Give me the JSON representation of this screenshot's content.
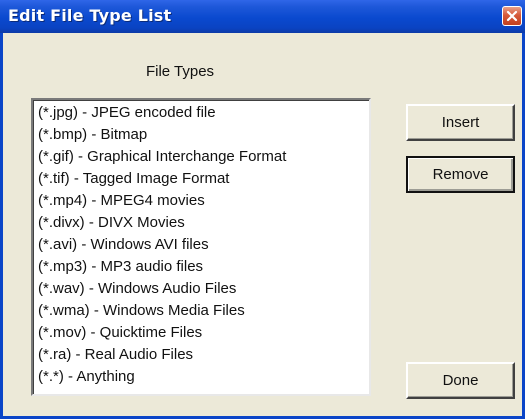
{
  "window": {
    "title": "Edit File Type List"
  },
  "list_label": "File Types",
  "file_types": [
    "(*.jpg) - JPEG encoded file",
    "(*.bmp) - Bitmap",
    "(*.gif) - Graphical Interchange Format",
    "(*.tif) - Tagged Image Format",
    "(*.mp4) - MPEG4 movies",
    "(*.divx) - DIVX Movies",
    "(*.avi) - Windows AVI files",
    "(*.mp3) - MP3 audio files",
    "(*.wav) - Windows Audio Files",
    "(*.wma) - Windows Media Files",
    "(*.mov) - Quicktime Files",
    "(*.ra) - Real Audio Files",
    "(*.*) - Anything"
  ],
  "buttons": {
    "insert": "Insert",
    "remove": "Remove",
    "done": "Done"
  },
  "icons": {
    "close": "close-icon"
  },
  "colors": {
    "titlebar": "#0a49cf",
    "close_button": "#d65a3a",
    "dialog_background": "#ece9d8"
  }
}
